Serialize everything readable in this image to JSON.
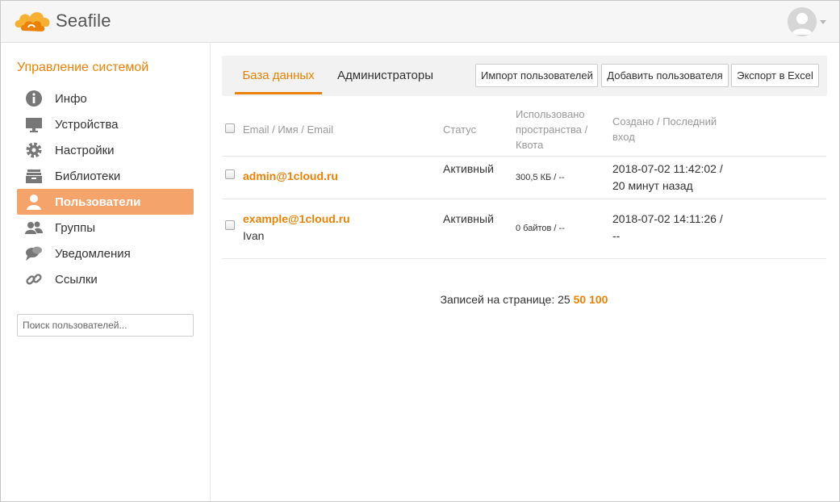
{
  "app": {
    "logo_text": "Seafile"
  },
  "sidebar": {
    "heading": "Управление системой",
    "items": [
      {
        "label": "Инфо",
        "icon": "info-icon"
      },
      {
        "label": "Устройства",
        "icon": "monitor-icon"
      },
      {
        "label": "Настройки",
        "icon": "gear-icon"
      },
      {
        "label": "Библиотеки",
        "icon": "archive-icon"
      },
      {
        "label": "Пользователи",
        "icon": "user-icon",
        "active": true
      },
      {
        "label": "Группы",
        "icon": "group-icon"
      },
      {
        "label": "Уведомления",
        "icon": "chat-icon"
      },
      {
        "label": "Ссылки",
        "icon": "link-icon"
      }
    ],
    "search_placeholder": "Поиск пользователей..."
  },
  "tabs": {
    "database": "База данных",
    "admins": "Администраторы"
  },
  "toolbar": {
    "import_label": "Импорт пользователей",
    "add_label": "Добавить пользователя",
    "export_label": "Экспорт в Excel"
  },
  "table": {
    "headers": {
      "email": "Email / Имя / Email",
      "status": "Статус",
      "space_1": "Использовано",
      "space_2": "пространства /",
      "space_3": "Квота",
      "created_1": "Создано / Последний",
      "created_2": "вход"
    },
    "rows": [
      {
        "email": "admin@1cloud.ru",
        "name": "",
        "status": "Активный",
        "space": "300,5 КБ / --",
        "created": "2018-07-02 11:42:02 /",
        "last_login": "20 минут назад"
      },
      {
        "email": "example@1cloud.ru",
        "name": "Ivan",
        "status": "Активный",
        "space": "0 байтов / --",
        "created": "2018-07-02 14:11:26 /",
        "last_login": "--"
      }
    ]
  },
  "pager": {
    "label": "Записей на странице:",
    "current": "25",
    "opt_50": "50",
    "opt_100": "100"
  },
  "colors": {
    "accent": "#eb8205",
    "active_bg": "#f4a36a"
  }
}
